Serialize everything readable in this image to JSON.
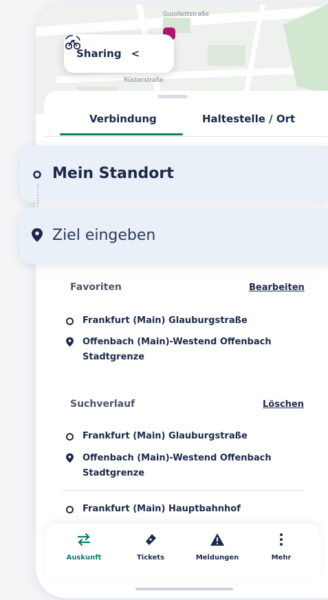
{
  "map": {
    "street_top": "Guiollettstraße",
    "street_mid": "Rüsterstraße"
  },
  "sharing": {
    "label": "Sharing",
    "chevron": "<",
    "icon": "bike-sharing-icon"
  },
  "tabs": [
    {
      "label": "Verbindung",
      "active": true
    },
    {
      "label": "Haltestelle / Ort",
      "active": false
    }
  ],
  "from": {
    "value": "Mein Standort"
  },
  "to": {
    "placeholder": "Ziel eingeben"
  },
  "favorites": {
    "title": "Favoriten",
    "action": "Bearbeiten",
    "items": [
      {
        "type": "stop",
        "text": "Frankfurt (Main) Glauburgstraße"
      },
      {
        "type": "place",
        "text": "Offenbach (Main)-Westend Offenbach Stadtgrenze"
      }
    ]
  },
  "history": {
    "title": "Suchverlauf",
    "action": "Löschen",
    "items": [
      {
        "type": "stop",
        "text": "Frankfurt (Main) Glauburgstraße"
      },
      {
        "type": "place",
        "text": "Offenbach (Main)-Westend Offenbach Stadtgrenze"
      },
      {
        "type": "stop",
        "text": "Frankfurt (Main) Hauptbahnhof"
      }
    ]
  },
  "nav": [
    {
      "label": "Auskunft",
      "icon": "swap-arrows-icon",
      "active": true
    },
    {
      "label": "Tickets",
      "icon": "ticket-icon",
      "active": false
    },
    {
      "label": "Meldungen",
      "icon": "warning-icon",
      "active": false
    },
    {
      "label": "Mehr",
      "icon": "more-vertical-icon",
      "active": false
    }
  ],
  "colors": {
    "accent": "#0b7a6b",
    "text": "#1b2a4a",
    "field_bg": "#eaf0f8",
    "pin": "#b0156f"
  }
}
